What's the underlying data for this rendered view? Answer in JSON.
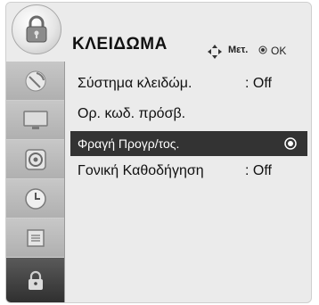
{
  "header": {
    "title": "ΚΛΕΙΔΩΜΑ",
    "move_hint": "Μετ.",
    "ok_hint": "OK",
    "icon": "lock-icon"
  },
  "sidebar": {
    "items": [
      {
        "icon": "satellite-dish-icon"
      },
      {
        "icon": "tv-screen-icon"
      },
      {
        "icon": "speaker-icon"
      },
      {
        "icon": "clock-icon"
      },
      {
        "icon": "options-box-icon"
      },
      {
        "icon": "lock-icon",
        "active": true
      }
    ]
  },
  "menu": {
    "items": [
      {
        "label": "Σύστημα κλειδώμ.",
        "value": ": Off"
      },
      {
        "label": "Ορ. κωδ. πρόσβ.",
        "value": ""
      },
      {
        "label": "Φραγή Προγρ/τος.",
        "value": "",
        "selected": true
      },
      {
        "label": "Γονική Καθοδήγηση",
        "value": ": Off"
      }
    ]
  },
  "colors": {
    "panel_bg": "#ebebeb",
    "sidebar_bg": "#b9b9b9",
    "selected_bg": "#333333",
    "selected_text": "#ffffff"
  }
}
